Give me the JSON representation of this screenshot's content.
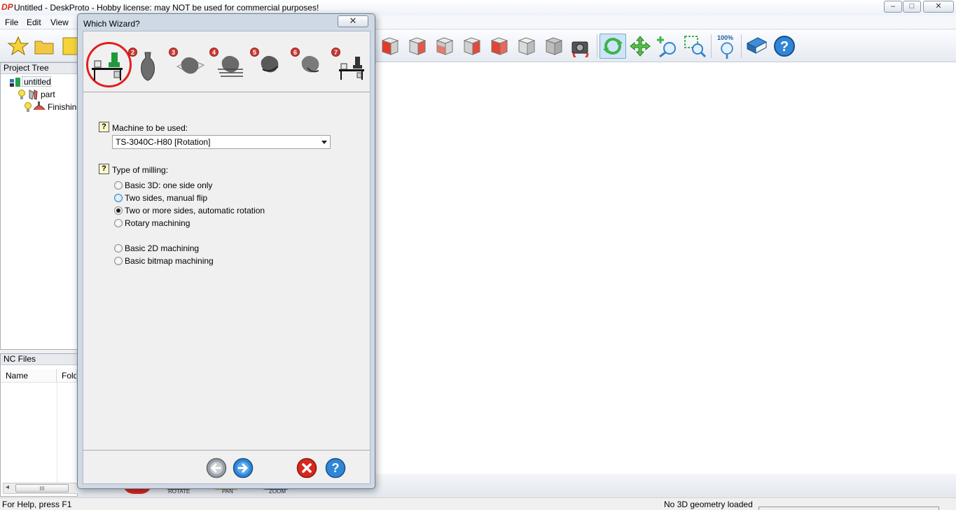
{
  "window": {
    "logo_text": "DP",
    "title": "Untitled - DeskProto - Hobby license: may NOT be used for commercial purposes!",
    "minimize": "–",
    "maximize": "□",
    "close": "✕"
  },
  "menu": {
    "file": "File",
    "edit": "Edit",
    "view": "View"
  },
  "project_tree": {
    "header": "Project Tree",
    "root": "untitled",
    "part": "part",
    "operation": "Finishing"
  },
  "nc_files": {
    "header": "NC Files",
    "columns": [
      "Name",
      "Folder"
    ],
    "scroll_grip": "III"
  },
  "toolbar": {
    "zoom_badge": "100%"
  },
  "view_captions": {
    "rotate": "ROTATE",
    "pan": "PAN",
    "zoom": "ZOOM"
  },
  "dialog": {
    "title": "Which Wizard?",
    "close": "✕",
    "steps": [
      "2",
      "3",
      "4",
      "5",
      "6",
      "7"
    ],
    "help_glyph": "?",
    "machine": {
      "label": "Machine to be used:",
      "selected": "TS-3040C-H80 [Rotation]"
    },
    "milling": {
      "label": "Type of milling:",
      "options": [
        "Basic 3D: one side only",
        "Two sides, manual flip",
        "Two or more sides, automatic rotation",
        "Rotary machining",
        "Basic 2D machining",
        "Basic bitmap machining"
      ],
      "selected_index": 2
    },
    "colors": {
      "accent_red": "#e11f1f",
      "step_badge": "#c73a34"
    }
  },
  "status": {
    "help": "For Help, press F1",
    "geometry": "No 3D geometry loaded"
  }
}
